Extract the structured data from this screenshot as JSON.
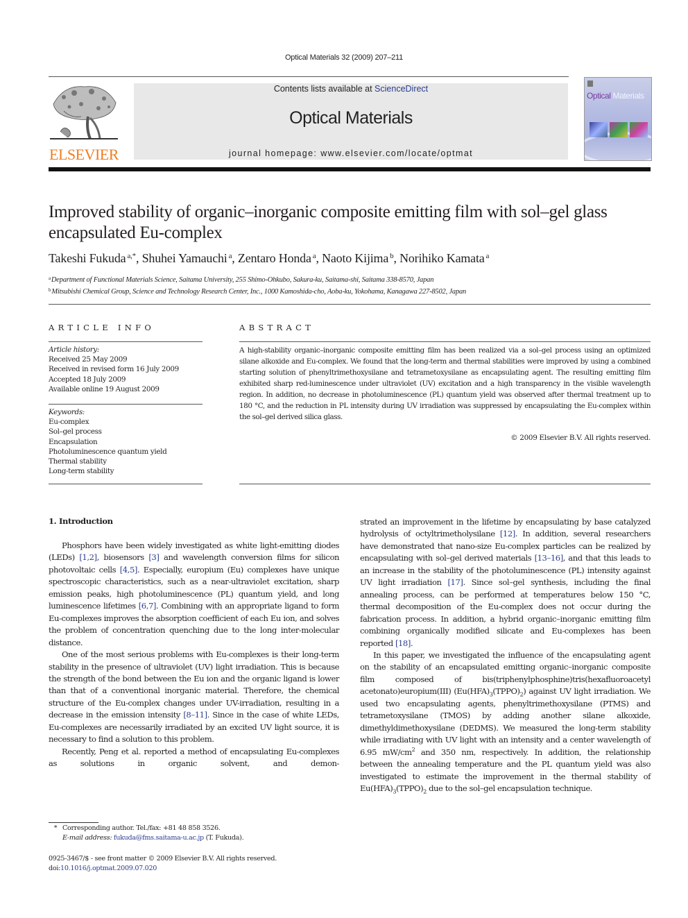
{
  "running_head": "Optical Materials 32 (2009) 207–211",
  "header": {
    "publisher_logo_text": "ELSEVIER",
    "contents_prefix": "Contents lists available at ",
    "contents_link": "ScienceDirect",
    "journal_name": "Optical Materials",
    "homepage_prefix": "journal homepage: ",
    "homepage_url": "www.elsevier.com/locate/optmat",
    "cover_title_part1": "Optical",
    "cover_title_part2": "Materials"
  },
  "article": {
    "title": "Improved stability of organic–inorganic composite emitting film with sol–gel glass encapsulated Eu-complex",
    "authors": [
      {
        "name": "Takeshi Fukuda",
        "sup": "a,*"
      },
      {
        "name": "Shuhei Yamauchi",
        "sup": "a"
      },
      {
        "name": "Zentaro Honda",
        "sup": "a"
      },
      {
        "name": "Naoto Kijima",
        "sup": "b"
      },
      {
        "name": "Norihiko Kamata",
        "sup": "a"
      }
    ],
    "affiliations": [
      {
        "mark": "a",
        "text": "Department of Functional Materials Science, Saitama University, 255 Shimo-Ohkubo, Sakura-ku, Saitama-shi, Saitama 338-8570, Japan"
      },
      {
        "mark": "b",
        "text": "Mitsubishi Chemical Group, Science and Technology Research Center, Inc., 1000 Kamoshida-cho, Aoba-ku, Yokohama, Kanagawa 227-8502, Japan"
      }
    ]
  },
  "article_info": {
    "heading": "ARTICLE INFO",
    "history_label": "Article history:",
    "history": [
      "Received 25 May 2009",
      "Received in revised form 16 July 2009",
      "Accepted 18 July 2009",
      "Available online 19 August 2009"
    ],
    "keywords_label": "Keywords:",
    "keywords": [
      "Eu-complex",
      "Sol–gel process",
      "Encapsulation",
      "Photoluminescence quantum yield",
      "Thermal stability",
      "Long-term stability"
    ]
  },
  "abstract": {
    "heading": "ABSTRACT",
    "text": "A high-stability organic–inorganic composite emitting film has been realized via a sol–gel process using an optimized silane alkoxide and Eu-complex. We found that the long-term and thermal stabilities were improved by using a combined starting solution of phenyltrimethoxysilane and tetrametoxysilane as encapsulating agent. The resulting emitting film exhibited sharp red-luminescence under ultraviolet (UV) excitation and a high transparency in the visible wavelength region. In addition, no decrease in photoluminescence (PL) quantum yield was observed after thermal treatment up to 180 °C, and the reduction in PL intensity during UV irradiation was suppressed by encapsulating the Eu-complex within the sol–gel derived silica glass.",
    "copyright": "© 2009 Elsevier B.V. All rights reserved."
  },
  "body": {
    "section_heading": "1. Introduction",
    "p1": {
      "a": "Phosphors have been widely investigated as white light-emitting diodes (LEDs) ",
      "r1": "[1,2]",
      "b": ", biosensors ",
      "r2": "[3]",
      "c": " and wavelength conversion films for silicon photovoltaic cells ",
      "r3": "[4,5]",
      "d": ". Especially, europium (Eu) complexes have unique spectroscopic characteristics, such as a near-ultraviolet excitation, sharp emission peaks, high photoluminescence (PL) quantum yield, and long luminescence lifetimes ",
      "r4": "[6,7]",
      "e": ". Combining with an appropriate ligand to form Eu-complexes improves the absorption coefficient of each Eu ion, and solves the problem of concentration quenching due to the long inter-molecular distance."
    },
    "p2": {
      "a": "One of the most serious problems with Eu-complexes is their long-term stability in the presence of ultraviolet (UV) light irradiation. This is because the strength of the bond between the Eu ion and the organic ligand is lower than that of a conventional inorganic material. Therefore, the chemical structure of the Eu-complex changes under UV-irradiation, resulting in a decrease in the emission intensity ",
      "r1": "[8–11]",
      "b": ". Since in the case of white LEDs, Eu-complexes are necessarily irradiated by an excited UV light source, it is necessary to find a solution to this problem."
    },
    "p3": {
      "a": "Recently, Peng et al. reported a method of encapsulating Eu-complexes as solutions in organic solvent, and demon-",
      "b": "strated an improvement in the lifetime by encapsulating by base catalyzed hydrolysis of octyltrimetholysilane ",
      "r1": "[12]",
      "c": ". In addition, several researchers have demonstrated that nano-size Eu-complex particles can be realized by encapsulating with sol–gel derived materials ",
      "r2": "[13–16]",
      "d": ", and that this leads to an increase in the stability of the photoluminescence (PL) intensity against UV light irradiation ",
      "r3": "[17]",
      "e": ". Since sol–gel synthesis, including the final annealing process, can be performed at temperatures below 150 °C, thermal decomposition of the Eu-complex does not occur during the fabrication process. In addition, a hybrid organic–inorganic emitting film combining organically modified silicate and Eu-complexes has been reported ",
      "r4": "[18]",
      "f": "."
    },
    "p4": {
      "a": "In this paper, we investigated the influence of the encapsulating agent on the stability of an encapsulated emitting organic–inorganic composite film composed of bis(triphenylphosphine)tris(hexafluoroacetyl acetonato)europium(III) (Eu(HFA)",
      "s1": "3",
      "b": "(TPPO)",
      "s2": "2",
      "c": ") against UV light irradiation. We used two encapsulating agents, phenyltrimethoxysilane (PTMS) and tetrametoxysilane (TMOS) by adding another silane alkoxide, dimethyldimethoxysilane (DEDMS). We measured the long-term stability while irradiating with UV light with an intensity and a center wavelength of 6.95 mW/cm",
      "s3": "2",
      "d": " and 350 nm, respectively. In addition, the relationship between the annealing temperature and the PL quantum yield was also investigated to estimate the improvement in the thermal stability of Eu(HFA)",
      "s4": "3",
      "e": "(TPPO)",
      "s5": "2",
      "f": " due to the sol–gel encapsulation technique."
    }
  },
  "footnotes": {
    "star": "*",
    "corresponding": "Corresponding author. Tel./fax: +81 48 858 3526.",
    "email_label": "E-mail address:",
    "email": "fukuda@fms.saitama-u.ac.jp",
    "email_suffix": " (T. Fukuda).",
    "front_matter": "0925-3467/$ - see front matter © 2009 Elsevier B.V. All rights reserved.",
    "doi_label": "doi:",
    "doi": "10.1016/j.optmat.2009.07.020"
  },
  "colors": {
    "elsevier_orange": "#f07c1f",
    "link_blue": "#2a3c8f",
    "banner_gray": "#e8e8e8"
  }
}
